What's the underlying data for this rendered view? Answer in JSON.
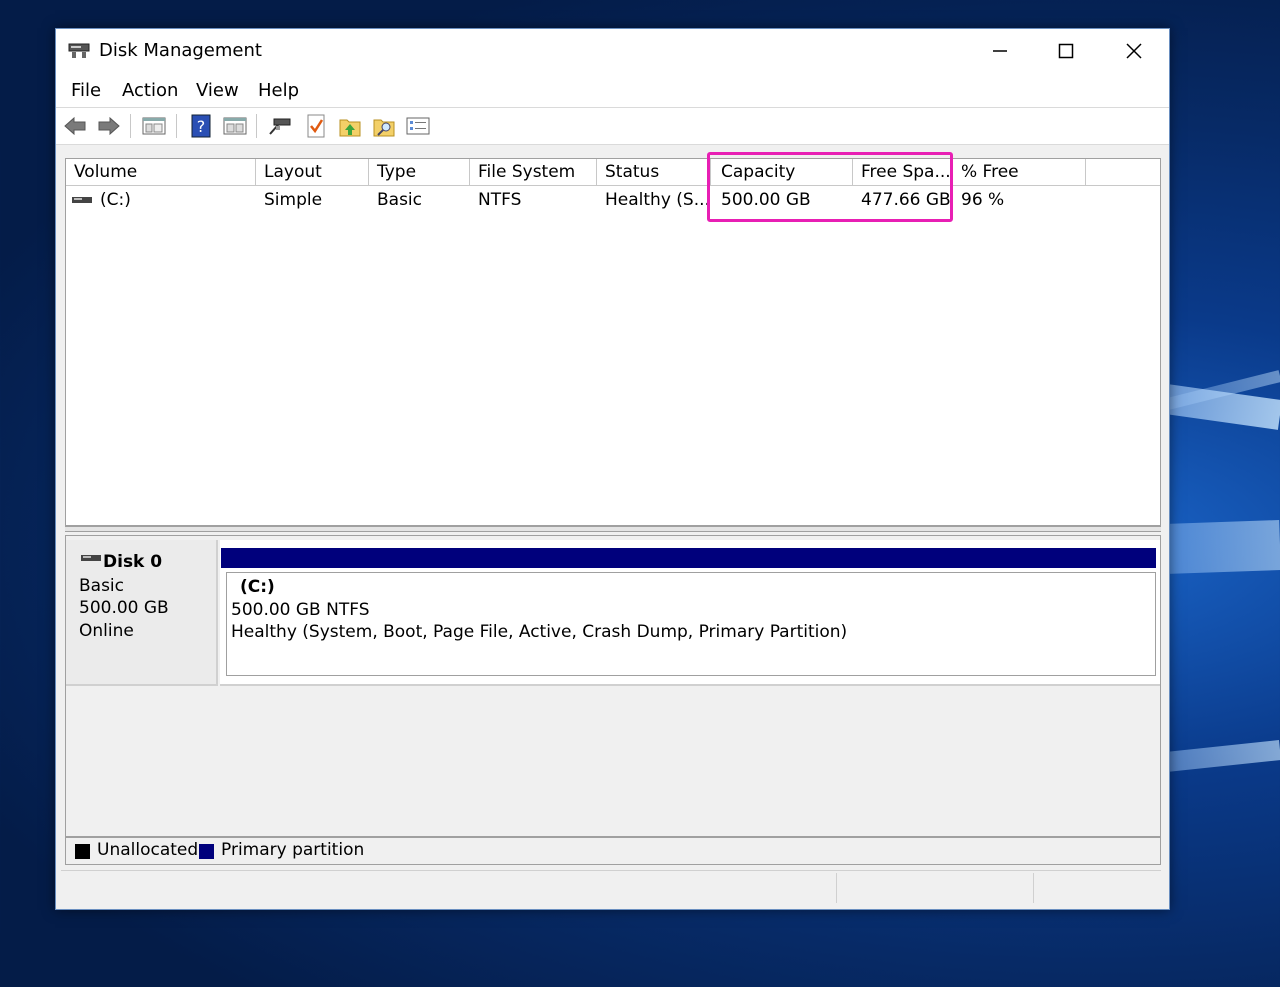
{
  "window": {
    "title": "Disk Management",
    "app_icon": "disk-management-icon",
    "controls": [
      "minimize-icon",
      "maximize-icon",
      "close-icon"
    ]
  },
  "menu": {
    "file": "File",
    "action": "Action",
    "view": "View",
    "help": "Help"
  },
  "toolbar": {
    "icons": [
      "back-arrow-icon",
      "forward-arrow-icon",
      "console-tree-icon",
      "help-icon",
      "show-hide-pane-icon",
      "connect-icon",
      "properties-icon",
      "up-folder-icon",
      "find-icon",
      "settings-list-icon"
    ]
  },
  "volume_list": {
    "columns": {
      "volume": "Volume",
      "layout": "Layout",
      "type": "Type",
      "file_system": "File System",
      "status": "Status",
      "capacity": "Capacity",
      "free_space": "Free Spa...",
      "percent_free": "% Free"
    },
    "rows": [
      {
        "volume": "(C:)",
        "layout": "Simple",
        "type": "Basic",
        "file_system": "NTFS",
        "status": "Healthy (S...",
        "capacity": "500.00 GB",
        "free_space": "477.66 GB",
        "percent_free": "96 %"
      }
    ]
  },
  "disks": [
    {
      "name": "Disk 0",
      "type": "Basic",
      "size": "500.00 GB",
      "state": "Online",
      "partition": {
        "label": "(C:)",
        "size_fs": "500.00 GB NTFS",
        "status": "Healthy (System, Boot, Page File, Active, Crash Dump, Primary Partition)"
      }
    }
  ],
  "legend": {
    "unallocated": "Unallocated",
    "primary": "Primary partition"
  },
  "colors": {
    "primary_partition": "#00007c",
    "unallocated": "#000000",
    "highlight": "#e81fb4"
  }
}
